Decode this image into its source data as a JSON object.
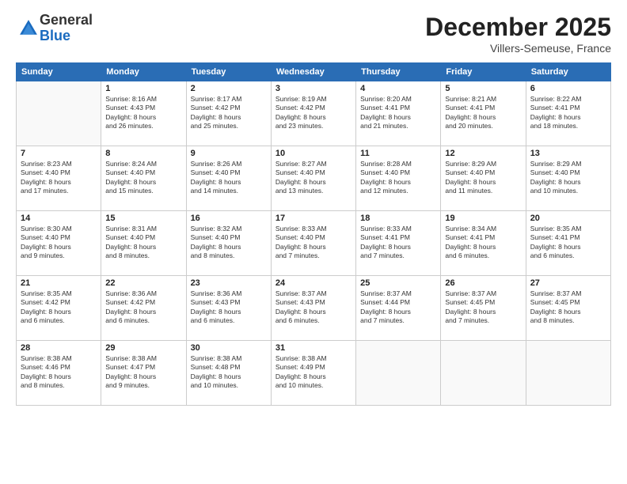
{
  "logo": {
    "general": "General",
    "blue": "Blue"
  },
  "header": {
    "month": "December 2025",
    "location": "Villers-Semeuse, France"
  },
  "weekdays": [
    "Sunday",
    "Monday",
    "Tuesday",
    "Wednesday",
    "Thursday",
    "Friday",
    "Saturday"
  ],
  "weeks": [
    [
      {
        "day": "",
        "info": ""
      },
      {
        "day": "1",
        "info": "Sunrise: 8:16 AM\nSunset: 4:43 PM\nDaylight: 8 hours\nand 26 minutes."
      },
      {
        "day": "2",
        "info": "Sunrise: 8:17 AM\nSunset: 4:42 PM\nDaylight: 8 hours\nand 25 minutes."
      },
      {
        "day": "3",
        "info": "Sunrise: 8:19 AM\nSunset: 4:42 PM\nDaylight: 8 hours\nand 23 minutes."
      },
      {
        "day": "4",
        "info": "Sunrise: 8:20 AM\nSunset: 4:41 PM\nDaylight: 8 hours\nand 21 minutes."
      },
      {
        "day": "5",
        "info": "Sunrise: 8:21 AM\nSunset: 4:41 PM\nDaylight: 8 hours\nand 20 minutes."
      },
      {
        "day": "6",
        "info": "Sunrise: 8:22 AM\nSunset: 4:41 PM\nDaylight: 8 hours\nand 18 minutes."
      }
    ],
    [
      {
        "day": "7",
        "info": "Sunrise: 8:23 AM\nSunset: 4:40 PM\nDaylight: 8 hours\nand 17 minutes."
      },
      {
        "day": "8",
        "info": "Sunrise: 8:24 AM\nSunset: 4:40 PM\nDaylight: 8 hours\nand 15 minutes."
      },
      {
        "day": "9",
        "info": "Sunrise: 8:26 AM\nSunset: 4:40 PM\nDaylight: 8 hours\nand 14 minutes."
      },
      {
        "day": "10",
        "info": "Sunrise: 8:27 AM\nSunset: 4:40 PM\nDaylight: 8 hours\nand 13 minutes."
      },
      {
        "day": "11",
        "info": "Sunrise: 8:28 AM\nSunset: 4:40 PM\nDaylight: 8 hours\nand 12 minutes."
      },
      {
        "day": "12",
        "info": "Sunrise: 8:29 AM\nSunset: 4:40 PM\nDaylight: 8 hours\nand 11 minutes."
      },
      {
        "day": "13",
        "info": "Sunrise: 8:29 AM\nSunset: 4:40 PM\nDaylight: 8 hours\nand 10 minutes."
      }
    ],
    [
      {
        "day": "14",
        "info": "Sunrise: 8:30 AM\nSunset: 4:40 PM\nDaylight: 8 hours\nand 9 minutes."
      },
      {
        "day": "15",
        "info": "Sunrise: 8:31 AM\nSunset: 4:40 PM\nDaylight: 8 hours\nand 8 minutes."
      },
      {
        "day": "16",
        "info": "Sunrise: 8:32 AM\nSunset: 4:40 PM\nDaylight: 8 hours\nand 8 minutes."
      },
      {
        "day": "17",
        "info": "Sunrise: 8:33 AM\nSunset: 4:40 PM\nDaylight: 8 hours\nand 7 minutes."
      },
      {
        "day": "18",
        "info": "Sunrise: 8:33 AM\nSunset: 4:41 PM\nDaylight: 8 hours\nand 7 minutes."
      },
      {
        "day": "19",
        "info": "Sunrise: 8:34 AM\nSunset: 4:41 PM\nDaylight: 8 hours\nand 6 minutes."
      },
      {
        "day": "20",
        "info": "Sunrise: 8:35 AM\nSunset: 4:41 PM\nDaylight: 8 hours\nand 6 minutes."
      }
    ],
    [
      {
        "day": "21",
        "info": "Sunrise: 8:35 AM\nSunset: 4:42 PM\nDaylight: 8 hours\nand 6 minutes."
      },
      {
        "day": "22",
        "info": "Sunrise: 8:36 AM\nSunset: 4:42 PM\nDaylight: 8 hours\nand 6 minutes."
      },
      {
        "day": "23",
        "info": "Sunrise: 8:36 AM\nSunset: 4:43 PM\nDaylight: 8 hours\nand 6 minutes."
      },
      {
        "day": "24",
        "info": "Sunrise: 8:37 AM\nSunset: 4:43 PM\nDaylight: 8 hours\nand 6 minutes."
      },
      {
        "day": "25",
        "info": "Sunrise: 8:37 AM\nSunset: 4:44 PM\nDaylight: 8 hours\nand 7 minutes."
      },
      {
        "day": "26",
        "info": "Sunrise: 8:37 AM\nSunset: 4:45 PM\nDaylight: 8 hours\nand 7 minutes."
      },
      {
        "day": "27",
        "info": "Sunrise: 8:37 AM\nSunset: 4:45 PM\nDaylight: 8 hours\nand 8 minutes."
      }
    ],
    [
      {
        "day": "28",
        "info": "Sunrise: 8:38 AM\nSunset: 4:46 PM\nDaylight: 8 hours\nand 8 minutes."
      },
      {
        "day": "29",
        "info": "Sunrise: 8:38 AM\nSunset: 4:47 PM\nDaylight: 8 hours\nand 9 minutes."
      },
      {
        "day": "30",
        "info": "Sunrise: 8:38 AM\nSunset: 4:48 PM\nDaylight: 8 hours\nand 10 minutes."
      },
      {
        "day": "31",
        "info": "Sunrise: 8:38 AM\nSunset: 4:49 PM\nDaylight: 8 hours\nand 10 minutes."
      },
      {
        "day": "",
        "info": ""
      },
      {
        "day": "",
        "info": ""
      },
      {
        "day": "",
        "info": ""
      }
    ]
  ]
}
